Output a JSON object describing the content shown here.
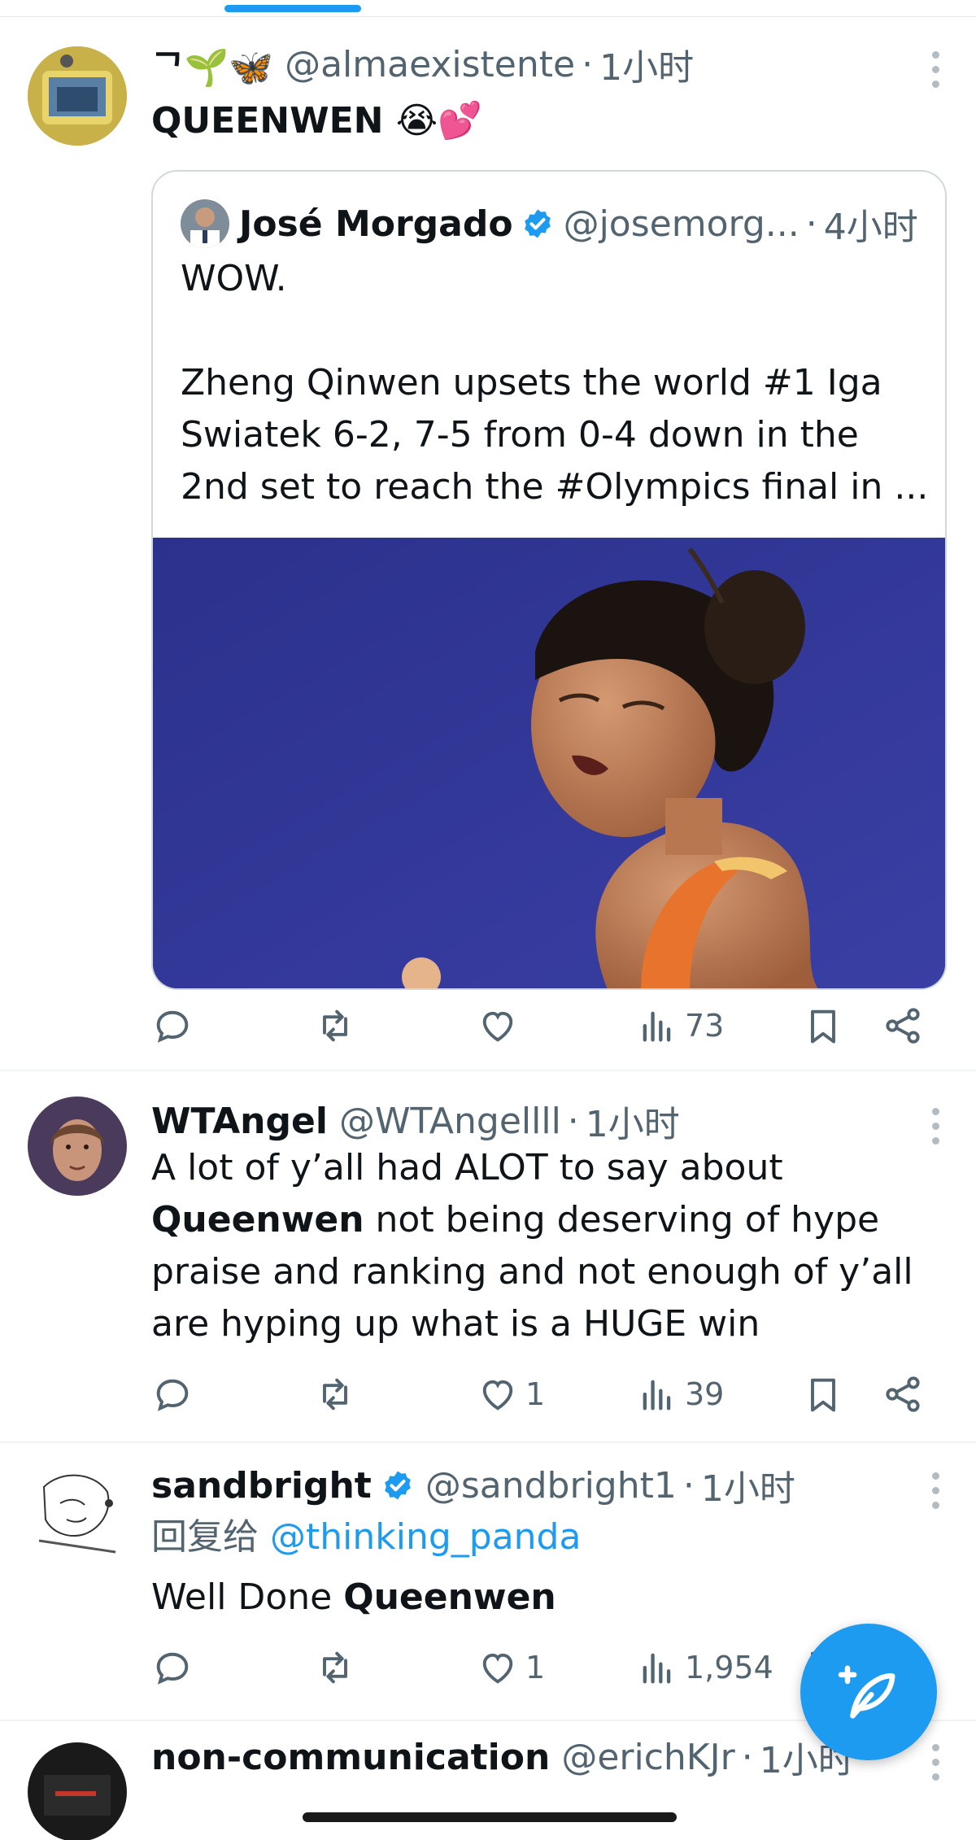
{
  "tweets": [
    {
      "name": "ᄀ🌱🦋",
      "handle": "@almaexistente",
      "dot": "·",
      "time": "1小时",
      "text": "QUEENWEN 😭💕",
      "actions": {
        "reply": "",
        "retweet": "",
        "like": "",
        "views": "73"
      },
      "quote": {
        "name": "José Morgado",
        "handle": "@josemorg...",
        "dot": "·",
        "time": "4小时",
        "text": "WOW.\n\nZheng Qinwen upsets the world #1 Iga Swiatek 6-2, 7-5 from 0-4 down in the 2nd set to reach the #Olympics final in ..."
      }
    },
    {
      "name": "WTAngel",
      "handle": "@WTAngellll",
      "dot": "·",
      "time": "1小时",
      "text_parts": [
        "A lot of y’all had ALOT to say about ",
        "Queenwen",
        " not being deserving of hype praise and ranking and not enough of y’all are hyping up what is a HUGE win"
      ],
      "actions": {
        "reply": "",
        "retweet": "",
        "like": "1",
        "views": "39"
      }
    },
    {
      "name": "sandbright",
      "handle": "@sandbright1",
      "dot": "·",
      "time": "1小时",
      "reply_prefix": "回复给 ",
      "reply_to": "@thinking_panda",
      "text_parts": [
        "Well Done ",
        "Queenwen"
      ],
      "actions": {
        "reply": "",
        "retweet": "",
        "like": "1",
        "views": "1,954"
      }
    },
    {
      "name": "non-communication",
      "handle": "@erichKJr",
      "dot": "·",
      "time": "1小时"
    }
  ],
  "colors": {
    "accent": "#1d9bf0",
    "verified": "#1d9bf0",
    "muted": "#536471"
  },
  "icons": [
    "reply-icon",
    "retweet-icon",
    "like-icon",
    "views-icon",
    "bookmark-icon",
    "share-icon",
    "more-icon",
    "verified-badge-icon",
    "compose-icon"
  ]
}
